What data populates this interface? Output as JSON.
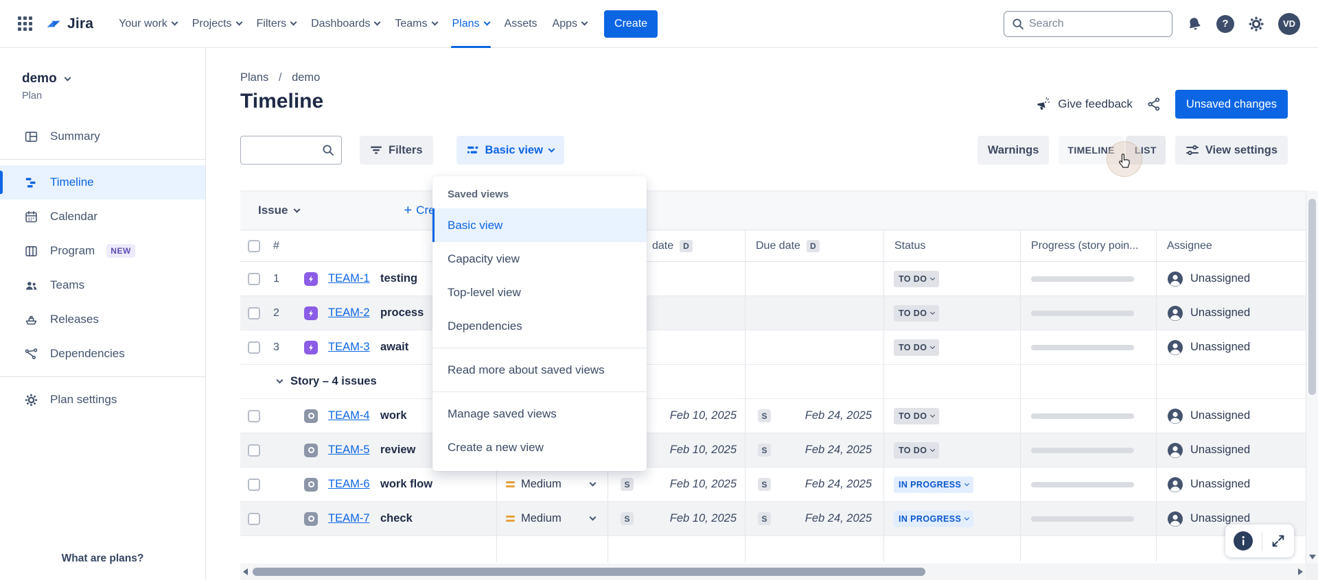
{
  "colors": {
    "accent": "#0C66E4",
    "epic": "#8B5CE6",
    "issue-gray": "#8C96A8",
    "priority-medium": "#E8A13B",
    "status-todo-bg": "#E0E2E7",
    "status-todo-text": "#39455E",
    "status-inprog-bg": "#E2EDFF",
    "status-inprog-text": "#0957CF",
    "selected-bg": "#E9F2FF",
    "new-badge-bg": "#EEEBFF",
    "new-badge-text": "#5E4DB2",
    "avatar-bg": "#3B4C68"
  },
  "topnav": {
    "logo_text": "Jira",
    "items": [
      {
        "label": "Your work",
        "chevron": true
      },
      {
        "label": "Projects",
        "chevron": true
      },
      {
        "label": "Filters",
        "chevron": true
      },
      {
        "label": "Dashboards",
        "chevron": true
      },
      {
        "label": "Teams",
        "chevron": true
      },
      {
        "label": "Plans",
        "chevron": true,
        "active": true
      },
      {
        "label": "Assets",
        "chevron": false
      },
      {
        "label": "Apps",
        "chevron": true
      }
    ],
    "create_label": "Create",
    "search_placeholder": "Search",
    "avatar_initials": "VD"
  },
  "sidebar": {
    "plan_name": "demo",
    "plan_type": "Plan",
    "items": [
      {
        "label": "Summary",
        "icon": "summary-icon"
      },
      {
        "divider": true
      },
      {
        "label": "Timeline",
        "icon": "timeline-icon",
        "active": true
      },
      {
        "label": "Calendar",
        "icon": "calendar-icon"
      },
      {
        "label": "Program",
        "icon": "program-icon",
        "badge": "NEW"
      },
      {
        "label": "Teams",
        "icon": "teams-icon"
      },
      {
        "label": "Releases",
        "icon": "releases-icon"
      },
      {
        "label": "Dependencies",
        "icon": "dependencies-icon"
      }
    ],
    "settings_label": "Plan settings",
    "footer_link": "What are plans?"
  },
  "header": {
    "breadcrumb_root": "Plans",
    "breadcrumb_sep": "/",
    "breadcrumb_current": "demo",
    "title": "Timeline",
    "give_feedback": "Give feedback",
    "unsaved_changes": "Unsaved changes"
  },
  "toolbar": {
    "filters_label": "Filters",
    "view_selector_label": "Basic view",
    "warnings_label": "Warnings",
    "mode_timeline": "TIMELINE",
    "mode_list": "LIST",
    "view_settings_label": "View settings"
  },
  "view_menu": {
    "section_label": "Saved views",
    "views": [
      {
        "label": "Basic view",
        "selected": true
      },
      {
        "label": "Capacity view"
      },
      {
        "label": "Top-level view"
      },
      {
        "label": "Dependencies"
      }
    ],
    "link_items": [
      "Read more about saved views"
    ],
    "action_items": [
      "Manage saved views",
      "Create a new view"
    ]
  },
  "table": {
    "issue_label": "Issue",
    "create_label": "Create",
    "columns": {
      "number": "#",
      "start_date": "date",
      "start_date_badge": "D",
      "due_date": "Due date",
      "due_date_badge": "D",
      "status": "Status",
      "progress": "Progress (story poin...",
      "assignee": "Assignee"
    },
    "rows": [
      {
        "kind": "issue",
        "num": "1",
        "type": "epic",
        "key": "TEAM-1",
        "summary": "testing",
        "priority": "",
        "start_date": "",
        "start_badge": "",
        "due_date": "",
        "due_badge": "",
        "status": "TO DO",
        "status_kind": "todo",
        "progress_pct": 0,
        "assignee": "Unassigned",
        "shaded": false
      },
      {
        "kind": "issue",
        "num": "2",
        "type": "epic",
        "key": "TEAM-2",
        "summary": "process",
        "priority": "",
        "start_date": "",
        "start_badge": "",
        "due_date": "",
        "due_badge": "",
        "status": "TO DO",
        "status_kind": "todo",
        "progress_pct": 0,
        "assignee": "Unassigned",
        "shaded": true
      },
      {
        "kind": "issue",
        "num": "3",
        "type": "epic",
        "key": "TEAM-3",
        "summary": "await",
        "priority": "",
        "start_date": "",
        "start_badge": "",
        "due_date": "",
        "due_badge": "",
        "status": "TO DO",
        "status_kind": "todo",
        "progress_pct": 0,
        "assignee": "Unassigned",
        "shaded": false
      },
      {
        "kind": "group",
        "label": "Story – 4 issues"
      },
      {
        "kind": "issue",
        "num": "",
        "type": "story",
        "key": "TEAM-4",
        "summary": "work",
        "priority": "",
        "start_date": "Feb 10, 2025",
        "start_badge": "S",
        "due_date": "Feb 24, 2025",
        "due_badge": "S",
        "status": "TO DO",
        "status_kind": "todo",
        "progress_pct": 0,
        "assignee": "Unassigned",
        "shaded": false
      },
      {
        "kind": "issue",
        "num": "",
        "type": "story",
        "key": "TEAM-5",
        "summary": "review",
        "priority": "",
        "start_date": "Feb 10, 2025",
        "start_badge": "S",
        "due_date": "Feb 24, 2025",
        "due_badge": "S",
        "status": "TO DO",
        "status_kind": "todo",
        "progress_pct": 0,
        "assignee": "Unassigned",
        "shaded": true
      },
      {
        "kind": "issue",
        "num": "",
        "type": "story",
        "key": "TEAM-6",
        "summary": "work flow",
        "priority": "Medium",
        "start_date": "Feb 10, 2025",
        "start_badge": "S",
        "due_date": "Feb 24, 2025",
        "due_badge": "S",
        "status": "IN PROGRESS",
        "status_kind": "inprogress",
        "progress_pct": 0,
        "assignee": "Unassigned",
        "shaded": false
      },
      {
        "kind": "issue",
        "num": "",
        "type": "story",
        "key": "TEAM-7",
        "summary": "check",
        "priority": "Medium",
        "start_date": "Feb 10, 2025",
        "start_badge": "S",
        "due_date": "Feb 24, 2025",
        "due_badge": "S",
        "status": "IN PROGRESS",
        "status_kind": "inprogress",
        "progress_pct": 0,
        "assignee": "Unassigned",
        "shaded": true
      }
    ]
  }
}
